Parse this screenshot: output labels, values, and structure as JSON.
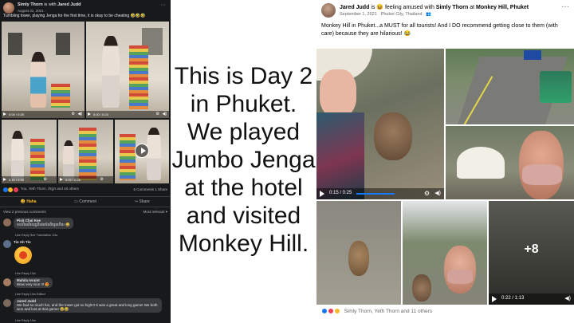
{
  "left_post": {
    "author": "Simly Thorn",
    "with_text": "is with",
    "with_name": "Jared Judd",
    "date": "August 31, 2021 · ",
    "more": "···",
    "caption": "Tumbling tower, playing Jenga for the first time, it is okay to be cheating 🤣🤣🤣",
    "video_times": [
      "0:00 / 0:25",
      "0:00 / 0:24",
      "0:15 / 0:25",
      "0:22 / 0:25"
    ],
    "reactions_text": "You, Yeth Thorn, ជាអ្នក and 46 others",
    "counts": "6 Comments  1 Share",
    "actions": {
      "haha": "Haha",
      "comment": "Comment",
      "share": "Share"
    },
    "view_previous": "View 2 previous comments",
    "most_relevant": "Most relevant ▾",
    "comments": [
      {
        "name": "Pisit Chai Kee",
        "text": "ចាប់ពីឈើចេញពីដងតាំងពីយូរហើយ 😂",
        "meta": "Like   Reply   See Translation   10w"
      },
      {
        "name": "Tin Ah Tin",
        "text": "",
        "meta": "Like   Reply   10w"
      },
      {
        "name": "Mahila Ivraint",
        "text": "Wow very nice !!! 😍",
        "meta": "Like   Reply   10w   Edited"
      },
      {
        "name": "Jared Judd",
        "text": "We had so much fun, and the tower got so high!!! It was a great and long game! We both won and lost at that game! 😂😂",
        "meta": "Like   Reply   10w"
      }
    ]
  },
  "center": {
    "lines": [
      "This is Day 2",
      "in Phuket.",
      "We played",
      "Jumbo Jenga",
      "at the hotel",
      "and visited",
      "Monkey Hill."
    ]
  },
  "right_post": {
    "author": "Jared Judd",
    "feeling": "is 😆 feeling amused with",
    "with_name": "Simly Thorn",
    "at": "at",
    "place": "Monkey Hill, Phuket",
    "meta": "September 1, 2021 · Phuket City, Thailand · 👥",
    "dots": "···",
    "caption": "Monkey Hill in Phuket...a MUST for all tourists! And I DO recommend getting close to them (with care) because they are hilarious! 😂",
    "video_time_main": "0:15 / 0:25",
    "video_time_last": "0:22 / 1:13",
    "more_count": "+8",
    "reactions_text": "Simly Thorn, Yeth Thorn and 11 others"
  },
  "colors": {
    "fb_dark_bg": "#18191a",
    "fb_blue": "#1877f2",
    "haha_yellow": "#f7b928",
    "love_red": "#f33e58"
  }
}
